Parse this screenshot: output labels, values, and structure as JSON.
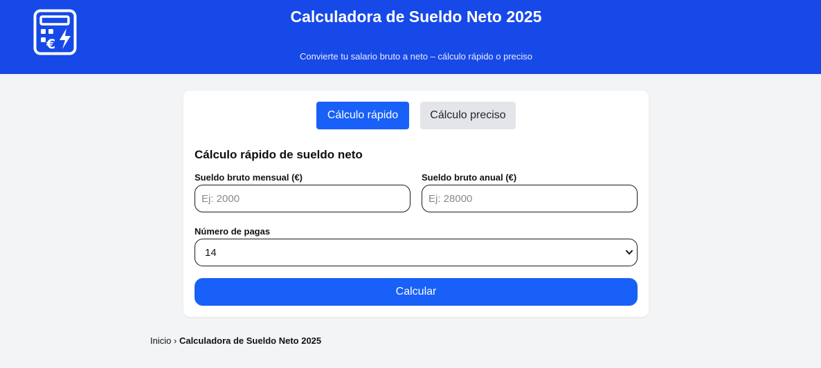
{
  "header": {
    "logo_icon": "calculator-euro-bolt-icon",
    "title": "Calculadora de Sueldo Neto 2025",
    "subtitle": "Convierte tu salario bruto a neto – cálculo rápido o preciso",
    "background": "#1749e8"
  },
  "tabs": {
    "quick_label": "Cálculo rápido",
    "precise_label": "Cálculo preciso",
    "active": "quick"
  },
  "form": {
    "section_title": "Cálculo rápido de sueldo neto",
    "monthly_label": "Sueldo bruto mensual (€)",
    "monthly_placeholder": "Ej: 2000",
    "monthly_value": "",
    "annual_label": "Sueldo bruto anual (€)",
    "annual_placeholder": "Ej: 28000",
    "annual_value": "",
    "payments_label": "Número de pagas",
    "payments_value": "14",
    "payments_arrow_icon": "chevron-down-icon",
    "calculate_label": "Calcular"
  },
  "breadcrumb": {
    "home": "Inicio",
    "separator": "›",
    "current": "Calculadora de Sueldo Neto 2025"
  },
  "colors": {
    "accent": "#1860f7",
    "page_background": "#f3f4f6",
    "inactive_tab": "#e4e5e9"
  }
}
